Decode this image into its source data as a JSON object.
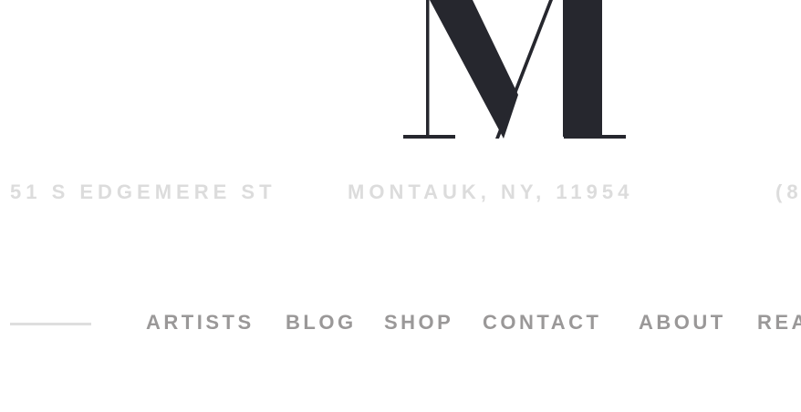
{
  "logo": {
    "letter": "M",
    "color": "#26272e"
  },
  "address": {
    "street": "51 S EDGEMERE ST",
    "city": "MONTAUK, NY, 11954",
    "phone_partial": "(8"
  },
  "nav": {
    "items": [
      {
        "label": "ARTISTS"
      },
      {
        "label": "BLOG"
      },
      {
        "label": "SHOP"
      },
      {
        "label": "CONTACT"
      },
      {
        "label": "ABOUT"
      },
      {
        "label": "REA"
      }
    ]
  },
  "colors": {
    "address_text": "#dcdcdc",
    "nav_text": "#9a9898",
    "divider": "#dedede"
  }
}
